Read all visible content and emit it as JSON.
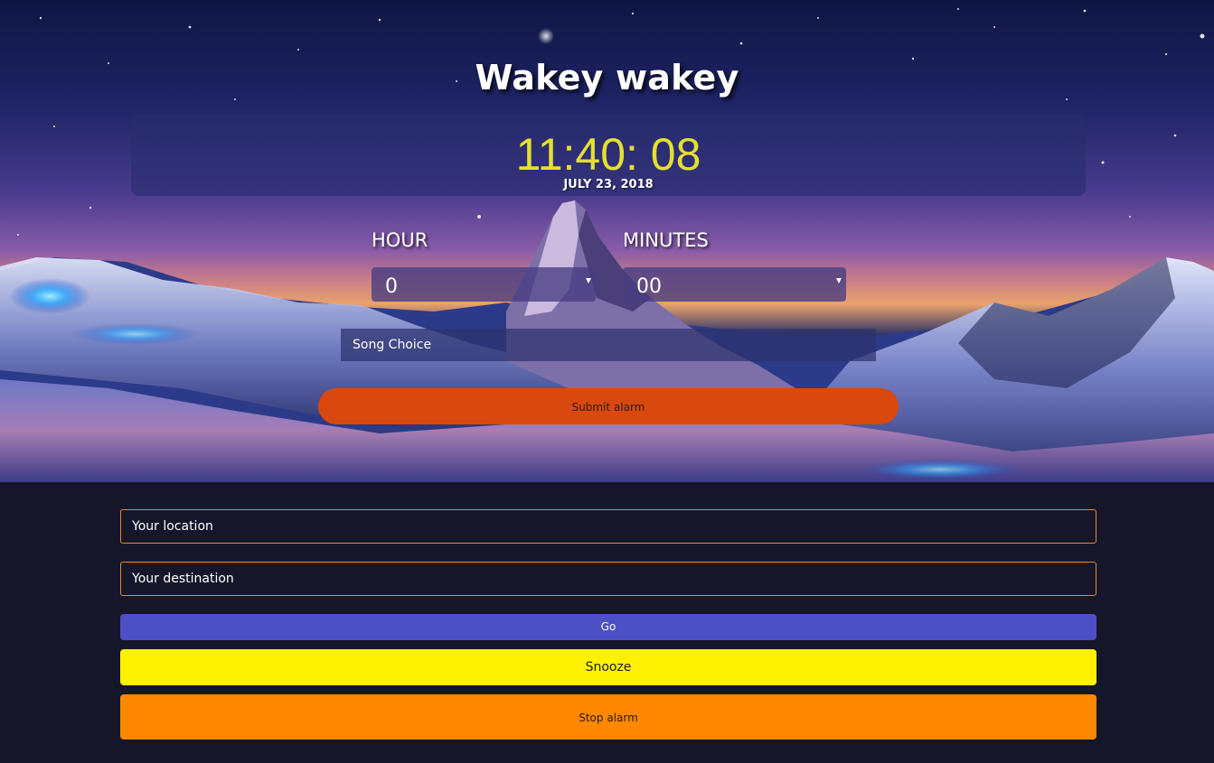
{
  "app": {
    "title": "Wakey wakey"
  },
  "clock": {
    "time": "11:40: 08",
    "date": "JULY 23, 2018"
  },
  "alarm_form": {
    "hour_label": "HOUR",
    "minutes_label": "MINUTES",
    "hour_value": "0",
    "minutes_value": "00",
    "song_choice_label": "Song Choice",
    "submit_label": "Submit alarm"
  },
  "route": {
    "location_placeholder": "Your location",
    "destination_placeholder": "Your destination",
    "go_label": "Go"
  },
  "controls": {
    "snooze_label": "Snooze",
    "stop_label": "Stop alarm"
  },
  "colors": {
    "clock_text": "#e3e031",
    "submit_button": "#d9480f",
    "go_button": "#4d4fc4",
    "snooze_button": "#fff200",
    "stop_button": "#ff8800",
    "input_border": "#e08a2c",
    "page_background": "#16162a"
  }
}
